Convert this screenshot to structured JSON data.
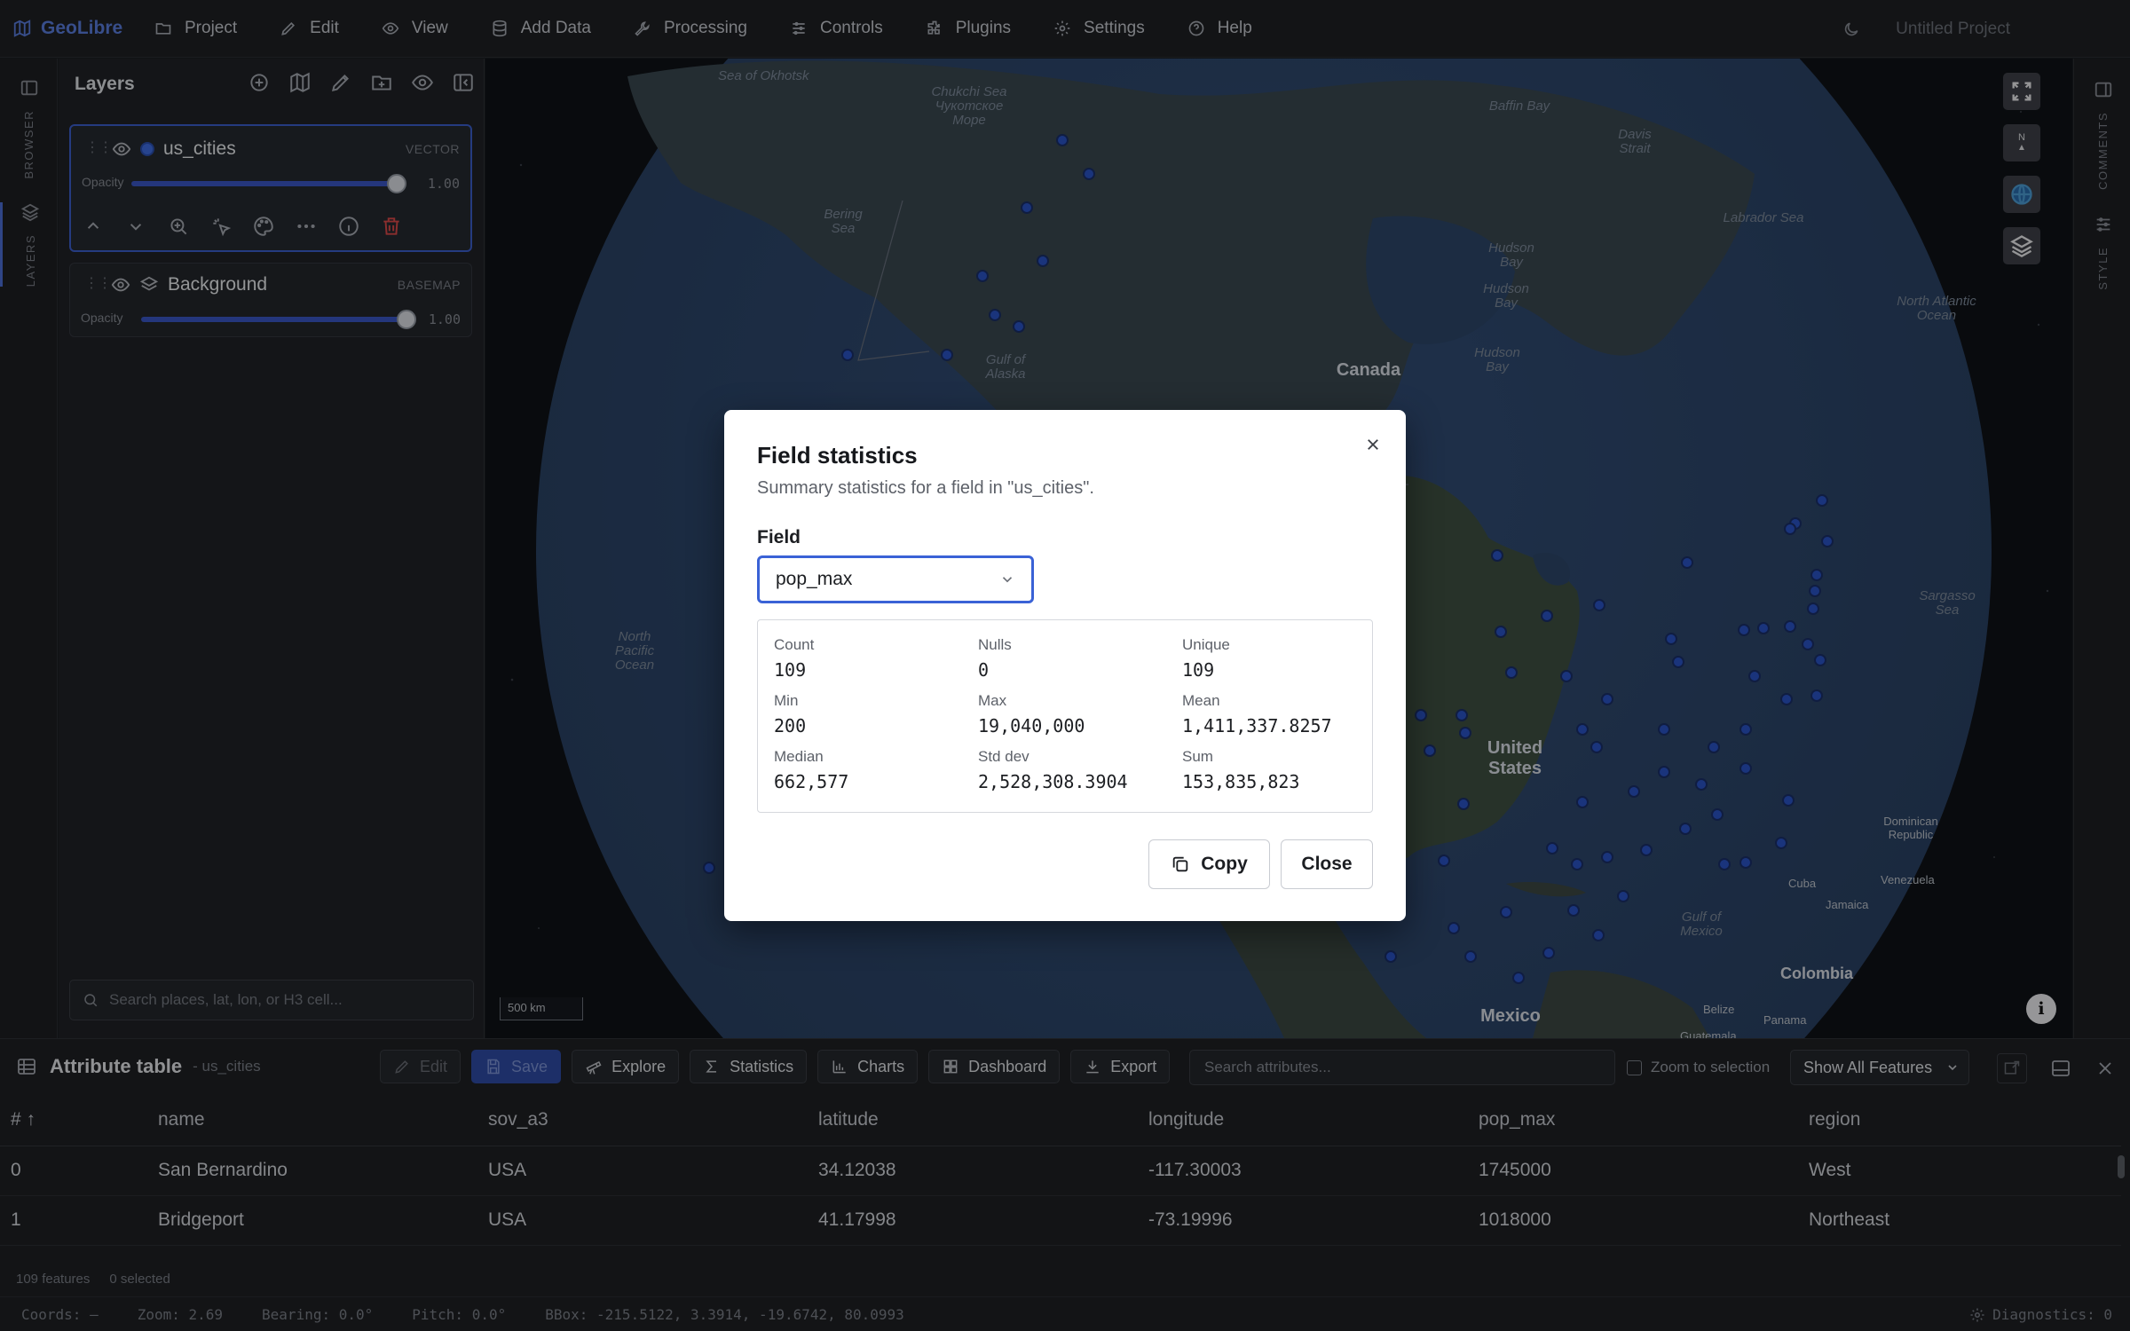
{
  "app": {
    "name": "GeoLibre",
    "project_name": "Untitled Project"
  },
  "menu": [
    {
      "label": "Project",
      "icon": "folder-icon"
    },
    {
      "label": "Edit",
      "icon": "pencil-icon"
    },
    {
      "label": "View",
      "icon": "eye-icon"
    },
    {
      "label": "Add Data",
      "icon": "database-icon"
    },
    {
      "label": "Processing",
      "icon": "wrench-icon"
    },
    {
      "label": "Controls",
      "icon": "sliders-icon"
    },
    {
      "label": "Plugins",
      "icon": "puzzle-icon"
    },
    {
      "label": "Settings",
      "icon": "gear-icon"
    },
    {
      "label": "Help",
      "icon": "help-circle-icon"
    }
  ],
  "left_rail": {
    "browser": "BROWSER",
    "layers": "LAYERS"
  },
  "right_rail": {
    "comments": "COMMENTS",
    "style": "STYLE"
  },
  "layers_panel": {
    "title": "Layers",
    "layers": [
      {
        "name": "us_cities",
        "kind": "VECTOR",
        "opacity_label": "Opacity",
        "opacity": "1.00",
        "color": "#3f6fe6"
      },
      {
        "name": "Background",
        "kind": "BASEMAP",
        "opacity_label": "Opacity",
        "opacity": "1.00"
      }
    ],
    "search_placeholder": "Search places, lat, lon, or H3 cell..."
  },
  "map": {
    "labels": {
      "sea_okhotsk": "Sea of Okhotsk",
      "chukchi": "Chukchi Sea Чукотское Море",
      "baffin": "Baffin Bay",
      "davis": "Davis Strait",
      "bering": "Bering Sea",
      "labrador": "Labrador Sea",
      "hudson1": "Hudson Bay",
      "hudson2": "Hudson Bay",
      "hudson3": "Hudson Bay",
      "gulf_alaska": "Gulf of Alaska",
      "north_atlantic": "North Atlantic Ocean",
      "north_pacific": "North Pacific Ocean",
      "sargasso": "Sargasso Sea",
      "gulf_mexico": "Gulf of Mexico"
    },
    "countries": {
      "canada": "Canada",
      "us": "United States",
      "mexico": "Mexico",
      "colombia": "Colombia"
    },
    "small": {
      "cuba": "Cuba",
      "dominican": "Dominican Republic",
      "jamaica": "Jamaica",
      "venezuela": "Venezuela",
      "belize": "Belize",
      "panama": "Panama",
      "guatemala": "Guatemala"
    },
    "compass_label": "N",
    "scale": "500 km"
  },
  "modal": {
    "title": "Field statistics",
    "subtitle": "Summary statistics for a field in \"us_cities\".",
    "field_label": "Field",
    "field_value": "pop_max",
    "stats": [
      {
        "label": "Count",
        "value": "109"
      },
      {
        "label": "Nulls",
        "value": "0"
      },
      {
        "label": "Unique",
        "value": "109"
      },
      {
        "label": "Min",
        "value": "200"
      },
      {
        "label": "Max",
        "value": "19,040,000"
      },
      {
        "label": "Mean",
        "value": "1,411,337.8257"
      },
      {
        "label": "Median",
        "value": "662,577"
      },
      {
        "label": "Std dev",
        "value": "2,528,308.3904"
      },
      {
        "label": "Sum",
        "value": "153,835,823"
      }
    ],
    "copy_label": "Copy",
    "close_label": "Close"
  },
  "attribute_table": {
    "title": "Attribute table",
    "subtitle": "- us_cities",
    "toolbar": {
      "edit": "Edit",
      "save": "Save",
      "explore": "Explore",
      "statistics": "Statistics",
      "charts": "Charts",
      "dashboard": "Dashboard",
      "export": "Export"
    },
    "search_placeholder": "Search attributes...",
    "zoom_to_selection": "Zoom to selection",
    "show_filter": "Show All Features",
    "columns": [
      "# ↑",
      "name",
      "sov_a3",
      "latitude",
      "longitude",
      "pop_max",
      "region"
    ],
    "rows": [
      [
        "0",
        "San Bernardino",
        "USA",
        "34.12038",
        "-117.30003",
        "1745000",
        "West"
      ],
      [
        "1",
        "Bridgeport",
        "USA",
        "41.17998",
        "-73.19996",
        "1018000",
        "Northeast"
      ]
    ],
    "footer": {
      "features": "109 features",
      "selected": "0 selected"
    }
  },
  "status_bar": {
    "coords": "Coords: —",
    "zoom": "Zoom: 2.69",
    "bearing": "Bearing: 0.0°",
    "pitch": "Pitch: 0.0°",
    "bbox": "BBox: -215.5122, 3.3914, -19.6742, 80.0993",
    "diagnostics": "Diagnostics: 0"
  }
}
